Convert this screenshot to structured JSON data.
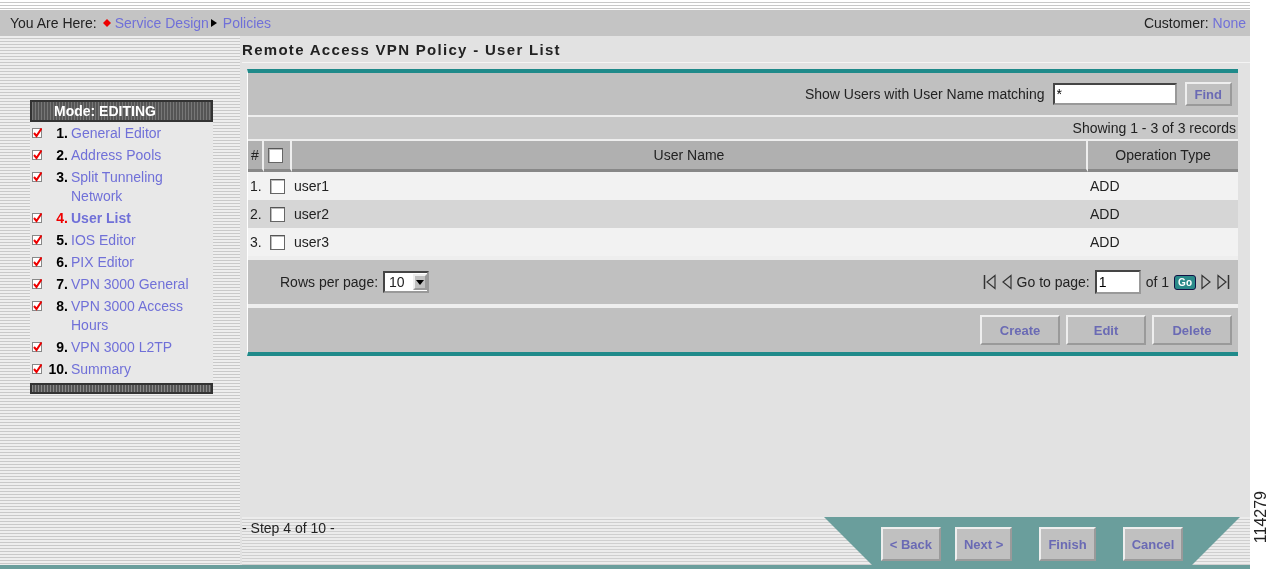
{
  "breadcrumb": {
    "label": "You Are Here:",
    "items": [
      {
        "text": "Service Design"
      },
      {
        "text": "Policies"
      }
    ]
  },
  "customer": {
    "label": "Customer:",
    "value": "None"
  },
  "mode": "Mode: EDITING",
  "steps": [
    {
      "number": "1.",
      "label": "General Editor",
      "checked": true,
      "selected": false
    },
    {
      "number": "2.",
      "label": "Address Pools",
      "checked": true,
      "selected": false
    },
    {
      "number": "3.",
      "label": "Split Tunneling Network",
      "checked": true,
      "selected": false
    },
    {
      "number": "4.",
      "label": "User List",
      "checked": true,
      "selected": true
    },
    {
      "number": "5.",
      "label": "IOS Editor",
      "checked": true,
      "selected": false
    },
    {
      "number": "6.",
      "label": "PIX Editor",
      "checked": true,
      "selected": false
    },
    {
      "number": "7.",
      "label": "VPN 3000 General",
      "checked": true,
      "selected": false
    },
    {
      "number": "8.",
      "label": "VPN 3000 Access Hours",
      "checked": true,
      "selected": false
    },
    {
      "number": "9.",
      "label": "VPN 3000 L2TP",
      "checked": true,
      "selected": false
    },
    {
      "number": "10.",
      "label": "Summary",
      "checked": true,
      "selected": false
    }
  ],
  "title": "Remote Access VPN Policy - User List",
  "filter": {
    "label": "Show Users with User Name matching",
    "value": "*",
    "button": "Find"
  },
  "records": "Showing 1 - 3 of 3 records",
  "table": {
    "columns": [
      "#",
      "User Name",
      "Operation Type"
    ],
    "all_checked": false,
    "rows": [
      {
        "index": "1.",
        "checked": false,
        "user": "user1",
        "operation": "ADD"
      },
      {
        "index": "2.",
        "checked": false,
        "user": "user2",
        "operation": "ADD"
      },
      {
        "index": "3.",
        "checked": false,
        "user": "user3",
        "operation": "ADD"
      }
    ]
  },
  "pagination": {
    "rows_label": "Rows per page:",
    "rows_value": "10",
    "goto_label": "Go to page:",
    "page": "1",
    "of": "of 1",
    "go": "Go"
  },
  "actions": [
    "Create",
    "Edit",
    "Delete"
  ],
  "step_text": "- Step 4 of 10 -",
  "wizard_buttons": [
    "< Back",
    "Next >",
    "Finish",
    "Cancel"
  ],
  "figure_number": "114279"
}
